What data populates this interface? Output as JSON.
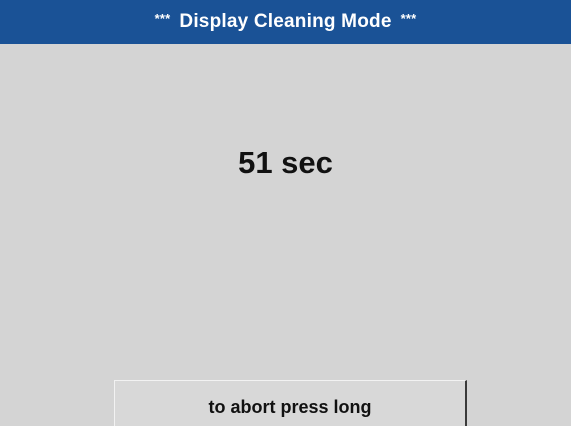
{
  "header": {
    "stars_left": "***",
    "title": "Display Cleaning Mode",
    "stars_right": "***"
  },
  "main": {
    "countdown": "51 sec"
  },
  "footer": {
    "abort_button_label": "to abort press long"
  },
  "colors": {
    "title_bar": "#1a5296",
    "background": "#d4d4d4"
  }
}
